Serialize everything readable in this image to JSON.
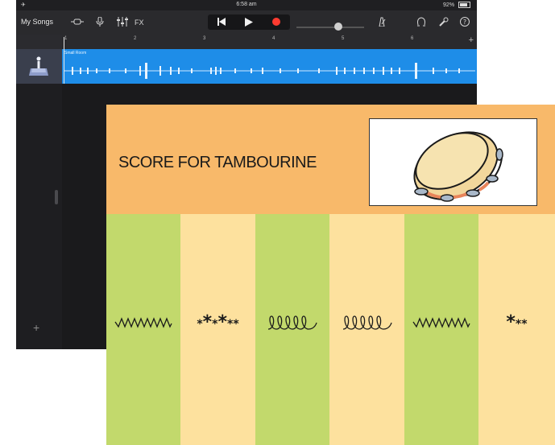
{
  "status_bar": {
    "left": "✈",
    "time": "6:58 am",
    "battery": "92%"
  },
  "toolbar": {
    "my_songs": "My Songs",
    "fx": "FX"
  },
  "timeline": {
    "bars": [
      "1",
      "2",
      "3",
      "4",
      "5",
      "6"
    ]
  },
  "track": {
    "region_name": "Small Room"
  },
  "score": {
    "title": "SCORE FOR TAMBOURINE",
    "columns": [
      {
        "color": "#c2d96c",
        "symbol": "zigzag"
      },
      {
        "color": "#fde19e",
        "symbol": "stars",
        "stars": [
          "small",
          "big",
          "small",
          "big",
          "small",
          "small"
        ]
      },
      {
        "color": "#c2d96c",
        "symbol": "loops"
      },
      {
        "color": "#fde19e",
        "symbol": "loops"
      },
      {
        "color": "#c2d96c",
        "symbol": "zigzag"
      },
      {
        "color": "#fde19e",
        "symbol": "stars",
        "stars": [
          "big",
          "small",
          "small"
        ]
      }
    ]
  },
  "colors": {
    "header": "#f8b96a",
    "green": "#c2d96c",
    "cream": "#fde19e",
    "region": "#1e8de8",
    "record": "#ff3b30"
  }
}
